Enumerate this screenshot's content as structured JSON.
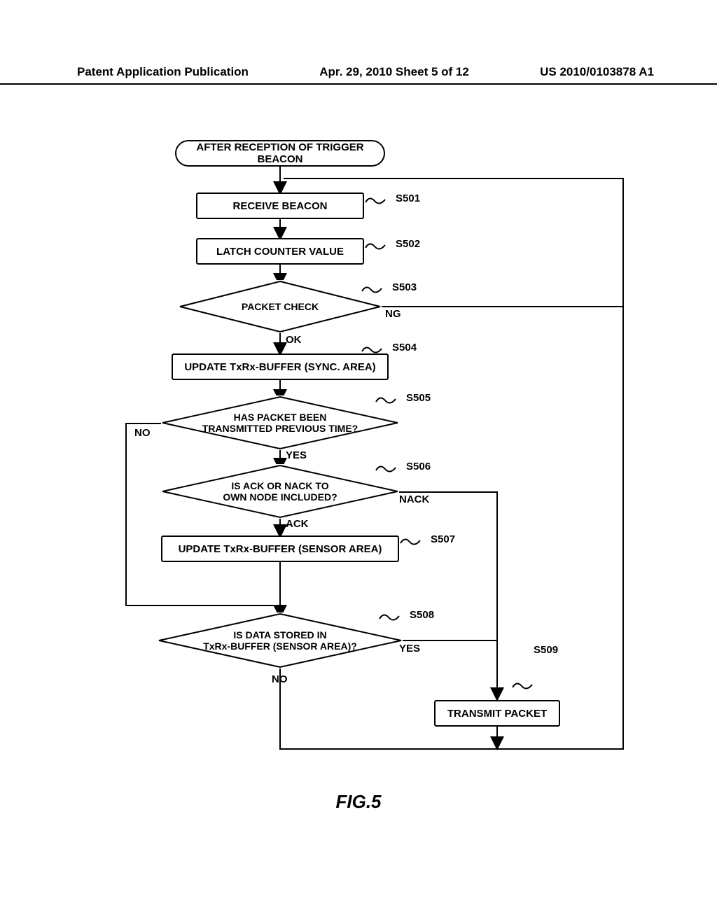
{
  "header": {
    "left": "Patent Application Publication",
    "center": "Apr. 29, 2010  Sheet 5 of 12",
    "right": "US 2010/0103878 A1"
  },
  "fig_caption": "FIG.5",
  "nodes": {
    "start": "AFTER RECEPTION OF TRIGGER BEACON",
    "s501": "RECEIVE BEACON",
    "s502": "LATCH COUNTER VALUE",
    "s503": "PACKET CHECK",
    "s504": "UPDATE TxRx-BUFFER (SYNC. AREA)",
    "s505": "HAS PACKET BEEN\nTRANSMITTED PREVIOUS TIME?",
    "s506": "IS ACK OR NACK TO\nOWN NODE INCLUDED?",
    "s507": "UPDATE TxRx-BUFFER (SENSOR AREA)",
    "s508": "IS DATA STORED IN\nTxRx-BUFFER (SENSOR AREA)?",
    "s509": "TRANSMIT PACKET"
  },
  "step_labels": {
    "s501": "S501",
    "s502": "S502",
    "s503": "S503",
    "s504": "S504",
    "s505": "S505",
    "s506": "S506",
    "s507": "S507",
    "s508": "S508",
    "s509": "S509"
  },
  "branch_labels": {
    "ok": "OK",
    "ng": "NG",
    "yes": "YES",
    "no": "NO",
    "ack": "ACK",
    "nack": "NACK"
  },
  "chart_data": {
    "type": "flowchart",
    "title": "FIG.5",
    "nodes": [
      {
        "id": "start",
        "type": "terminator",
        "label": "AFTER RECEPTION OF TRIGGER BEACON"
      },
      {
        "id": "S501",
        "type": "process",
        "label": "RECEIVE BEACON"
      },
      {
        "id": "S502",
        "type": "process",
        "label": "LATCH COUNTER VALUE"
      },
      {
        "id": "S503",
        "type": "decision",
        "label": "PACKET CHECK"
      },
      {
        "id": "S504",
        "type": "process",
        "label": "UPDATE TxRx-BUFFER (SYNC. AREA)"
      },
      {
        "id": "S505",
        "type": "decision",
        "label": "HAS PACKET BEEN TRANSMITTED PREVIOUS TIME?"
      },
      {
        "id": "S506",
        "type": "decision",
        "label": "IS ACK OR NACK TO OWN NODE INCLUDED?"
      },
      {
        "id": "S507",
        "type": "process",
        "label": "UPDATE TxRx-BUFFER (SENSOR AREA)"
      },
      {
        "id": "S508",
        "type": "decision",
        "label": "IS DATA STORED IN TxRx-BUFFER (SENSOR AREA)?"
      },
      {
        "id": "S509",
        "type": "process",
        "label": "TRANSMIT PACKET"
      }
    ],
    "edges": [
      {
        "from": "start",
        "to": "S501"
      },
      {
        "from": "S501",
        "to": "S502"
      },
      {
        "from": "S502",
        "to": "S503"
      },
      {
        "from": "S503",
        "to": "S504",
        "label": "OK"
      },
      {
        "from": "S503",
        "to": "loop_top",
        "label": "NG"
      },
      {
        "from": "S504",
        "to": "S505"
      },
      {
        "from": "S505",
        "to": "S506",
        "label": "YES"
      },
      {
        "from": "S505",
        "to": "S508",
        "label": "NO"
      },
      {
        "from": "S506",
        "to": "S507",
        "label": "ACK"
      },
      {
        "from": "S506",
        "to": "S509",
        "label": "NACK"
      },
      {
        "from": "S507",
        "to": "S508"
      },
      {
        "from": "S508",
        "to": "S509",
        "label": "YES"
      },
      {
        "from": "S508",
        "to": "loop_top",
        "label": "NO"
      },
      {
        "from": "S509",
        "to": "loop_top"
      }
    ]
  }
}
